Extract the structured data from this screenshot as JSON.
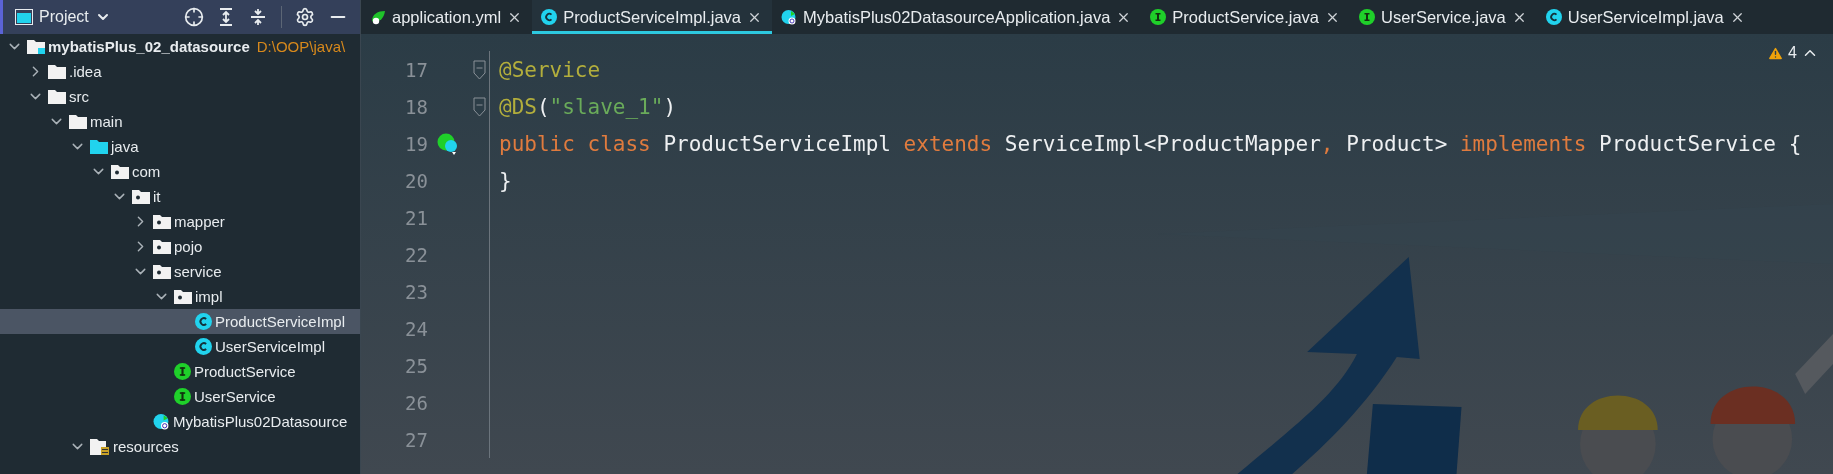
{
  "sidebar": {
    "title": "Project",
    "tree": [
      {
        "label": "mybatisPlus_02_datasource",
        "note": "D:\\OOP\\java\\",
        "kind": "module",
        "expanded": true,
        "selected": false,
        "children": [
          {
            "label": ".idea",
            "kind": "folder",
            "expanded": false,
            "selected": false
          },
          {
            "label": "src",
            "kind": "folder",
            "expanded": true,
            "selected": false,
            "children": [
              {
                "label": "main",
                "kind": "folder",
                "expanded": true,
                "selected": false,
                "children": [
                  {
                    "label": "java",
                    "kind": "source-folder",
                    "expanded": true,
                    "selected": false,
                    "children": [
                      {
                        "label": "com",
                        "kind": "package",
                        "expanded": true,
                        "selected": false,
                        "children": [
                          {
                            "label": "it",
                            "kind": "package",
                            "expanded": true,
                            "selected": false,
                            "children": [
                              {
                                "label": "mapper",
                                "kind": "package",
                                "expanded": false,
                                "selected": false
                              },
                              {
                                "label": "pojo",
                                "kind": "package",
                                "expanded": false,
                                "selected": false
                              },
                              {
                                "label": "service",
                                "kind": "package",
                                "expanded": true,
                                "selected": false,
                                "children": [
                                  {
                                    "label": "impl",
                                    "kind": "package",
                                    "expanded": true,
                                    "selected": false,
                                    "children": [
                                      {
                                        "label": "ProductServiceImpl",
                                        "kind": "class",
                                        "selected": true
                                      },
                                      {
                                        "label": "UserServiceImpl",
                                        "kind": "class",
                                        "selected": false
                                      }
                                    ]
                                  },
                                  {
                                    "label": "ProductService",
                                    "kind": "interface",
                                    "selected": false
                                  },
                                  {
                                    "label": "UserService",
                                    "kind": "interface",
                                    "selected": false
                                  }
                                ]
                              },
                              {
                                "label": "MybatisPlus02Datasource",
                                "kind": "spring-app",
                                "selected": false
                              }
                            ]
                          }
                        ]
                      }
                    ]
                  },
                  {
                    "label": "resources",
                    "kind": "resources",
                    "expanded": true,
                    "selected": false
                  }
                ]
              }
            ]
          }
        ]
      }
    ]
  },
  "tabs": [
    {
      "label": "application.yml",
      "kind": "yml",
      "selected": false
    },
    {
      "label": "ProductServiceImpl.java",
      "kind": "class",
      "selected": true
    },
    {
      "label": "MybatisPlus02DatasourceApplication.java",
      "kind": "spring-app",
      "selected": false
    },
    {
      "label": "ProductService.java",
      "kind": "interface",
      "selected": false
    },
    {
      "label": "UserService.java",
      "kind": "interface",
      "selected": false
    },
    {
      "label": "UserServiceImpl.java",
      "kind": "class",
      "selected": false
    }
  ],
  "inspections": {
    "warnings": "4"
  },
  "code": [
    {
      "number": "17",
      "fold": true,
      "tokens": [
        {
          "text": "@Service",
          "kind": "annotation"
        }
      ]
    },
    {
      "number": "18",
      "fold": true,
      "tokens": [
        {
          "text": "@DS",
          "kind": "annotation"
        },
        {
          "text": "(",
          "kind": "plain"
        },
        {
          "text": "\"slave_1\"",
          "kind": "string"
        },
        {
          "text": ")",
          "kind": "plain"
        }
      ]
    },
    {
      "number": "19",
      "bean_marker": true,
      "tokens": [
        {
          "text": "public class ",
          "kind": "keyword"
        },
        {
          "text": "ProductServiceImpl ",
          "kind": "plain"
        },
        {
          "text": "extends ",
          "kind": "keyword"
        },
        {
          "text": "ServiceImpl<ProductMapper",
          "kind": "plain"
        },
        {
          "text": ", ",
          "kind": "keyword"
        },
        {
          "text": "Product> ",
          "kind": "plain"
        },
        {
          "text": "implements ",
          "kind": "keyword"
        },
        {
          "text": "ProductService {",
          "kind": "plain"
        }
      ]
    },
    {
      "number": "20",
      "tokens": [
        {
          "text": "}",
          "kind": "plain"
        }
      ]
    },
    {
      "number": "21"
    },
    {
      "number": "22"
    },
    {
      "number": "23"
    },
    {
      "number": "24"
    },
    {
      "number": "25"
    },
    {
      "number": "26"
    },
    {
      "number": "27"
    }
  ]
}
